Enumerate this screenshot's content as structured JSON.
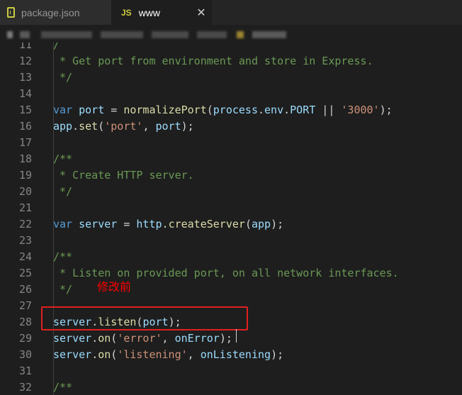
{
  "tabs": [
    {
      "label": "package.json",
      "icon": "json-file-icon",
      "active": false
    },
    {
      "label": "www",
      "icon_text": "JS",
      "active": true,
      "close_glyph": "✕"
    }
  ],
  "annotation": "修改前",
  "colors": {
    "keyword": "#569cd6",
    "variable": "#9cdcfe",
    "function": "#dcdcaa",
    "string": "#ce9178",
    "comment": "#6a9955",
    "annotation": "#ff0000"
  },
  "lines": [
    {
      "num": "11",
      "tokens": [
        [
          "com",
          "/"
        ]
      ]
    },
    {
      "num": "12",
      "tokens": [
        [
          "com",
          " * Get port from environment and store in Express."
        ]
      ]
    },
    {
      "num": "13",
      "tokens": [
        [
          "com",
          " */"
        ]
      ]
    },
    {
      "num": "14",
      "tokens": []
    },
    {
      "num": "15",
      "tokens": [
        [
          "kw",
          "var"
        ],
        [
          "op",
          " "
        ],
        [
          "var",
          "port"
        ],
        [
          "op",
          " = "
        ],
        [
          "fn",
          "normalizePort"
        ],
        [
          "op",
          "("
        ],
        [
          "var",
          "process"
        ],
        [
          "op",
          "."
        ],
        [
          "var",
          "env"
        ],
        [
          "op",
          "."
        ],
        [
          "var",
          "PORT"
        ],
        [
          "op",
          " || "
        ],
        [
          "str",
          "'3000'"
        ],
        [
          "op",
          ");"
        ]
      ]
    },
    {
      "num": "16",
      "tokens": [
        [
          "var",
          "app"
        ],
        [
          "op",
          "."
        ],
        [
          "fn",
          "set"
        ],
        [
          "op",
          "("
        ],
        [
          "str",
          "'port'"
        ],
        [
          "op",
          ", "
        ],
        [
          "var",
          "port"
        ],
        [
          "op",
          ");"
        ]
      ]
    },
    {
      "num": "17",
      "tokens": []
    },
    {
      "num": "18",
      "tokens": [
        [
          "com",
          "/**"
        ]
      ]
    },
    {
      "num": "19",
      "tokens": [
        [
          "com",
          " * Create HTTP server."
        ]
      ]
    },
    {
      "num": "20",
      "tokens": [
        [
          "com",
          " */"
        ]
      ]
    },
    {
      "num": "21",
      "tokens": []
    },
    {
      "num": "22",
      "tokens": [
        [
          "kw",
          "var"
        ],
        [
          "op",
          " "
        ],
        [
          "var",
          "server"
        ],
        [
          "op",
          " = "
        ],
        [
          "var",
          "http"
        ],
        [
          "op",
          "."
        ],
        [
          "fn",
          "createServer"
        ],
        [
          "op",
          "("
        ],
        [
          "var",
          "app"
        ],
        [
          "op",
          ");"
        ]
      ]
    },
    {
      "num": "23",
      "tokens": []
    },
    {
      "num": "24",
      "tokens": [
        [
          "com",
          "/**"
        ]
      ]
    },
    {
      "num": "25",
      "tokens": [
        [
          "com",
          " * Listen on provided port, on all network interfaces."
        ]
      ]
    },
    {
      "num": "26",
      "tokens": [
        [
          "com",
          " */"
        ]
      ]
    },
    {
      "num": "27",
      "tokens": []
    },
    {
      "num": "28",
      "tokens": [
        [
          "var",
          "server"
        ],
        [
          "op",
          "."
        ],
        [
          "fn",
          "listen"
        ],
        [
          "op",
          "("
        ],
        [
          "var",
          "port"
        ],
        [
          "op",
          ");"
        ]
      ]
    },
    {
      "num": "29",
      "tokens": [
        [
          "var",
          "server"
        ],
        [
          "op",
          "."
        ],
        [
          "fn",
          "on"
        ],
        [
          "op",
          "("
        ],
        [
          "str",
          "'error'"
        ],
        [
          "op",
          ", "
        ],
        [
          "var",
          "onError"
        ],
        [
          "op",
          ");"
        ]
      ]
    },
    {
      "num": "30",
      "tokens": [
        [
          "var",
          "server"
        ],
        [
          "op",
          "."
        ],
        [
          "fn",
          "on"
        ],
        [
          "op",
          "("
        ],
        [
          "str",
          "'listening'"
        ],
        [
          "op",
          ", "
        ],
        [
          "var",
          "onListening"
        ],
        [
          "op",
          ");"
        ]
      ]
    },
    {
      "num": "31",
      "tokens": []
    },
    {
      "num": "32",
      "tokens": [
        [
          "com",
          "/**"
        ]
      ]
    }
  ]
}
